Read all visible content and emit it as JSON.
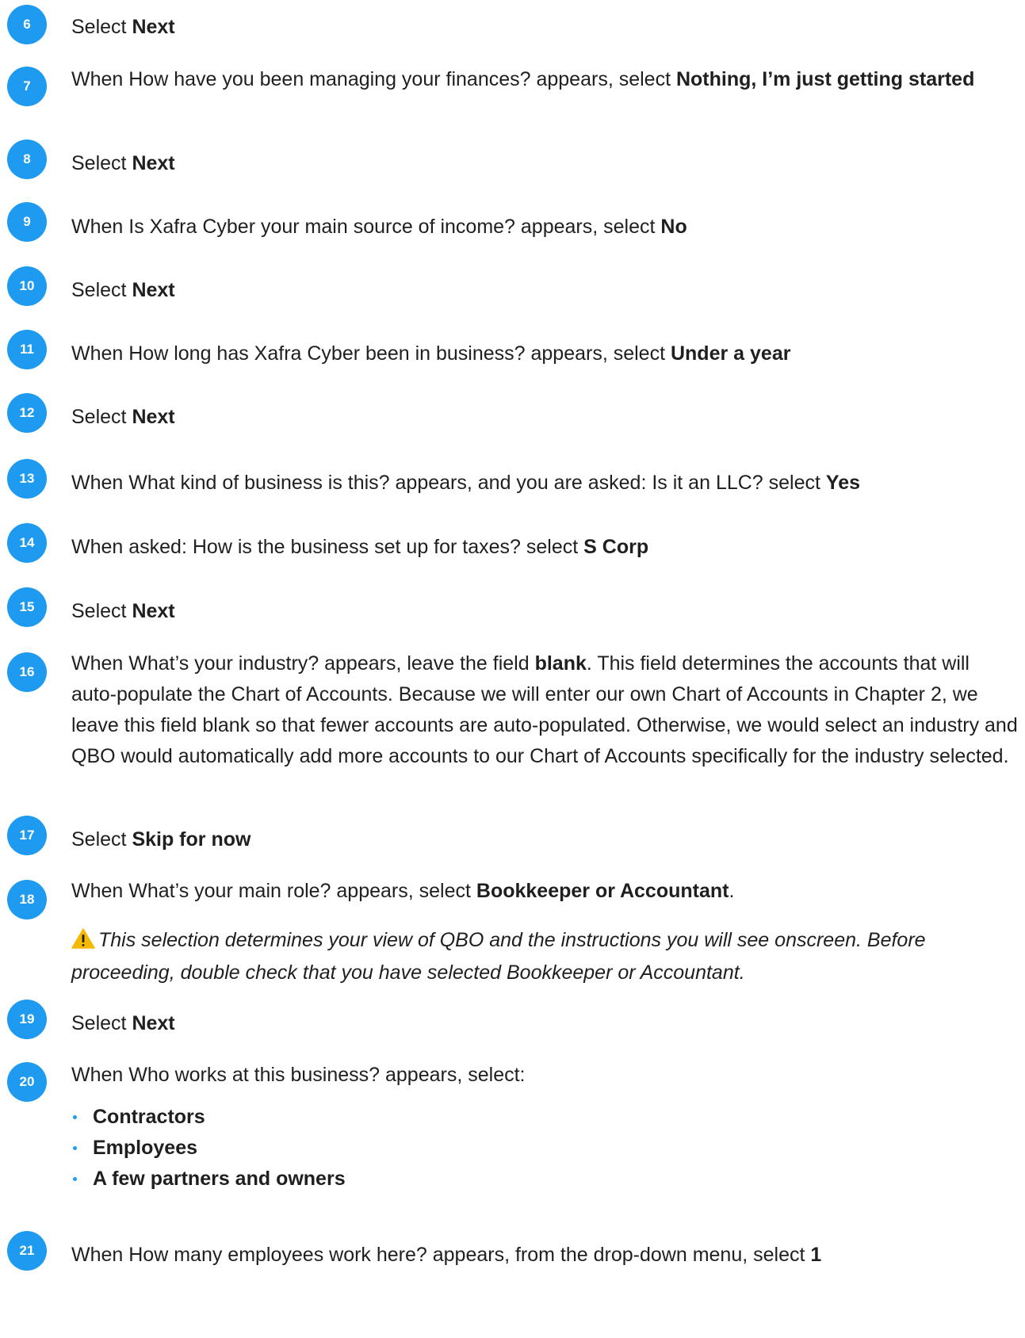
{
  "steps": [
    {
      "num": "6",
      "pre": "Select ",
      "bold": "Next",
      "post": ""
    },
    {
      "num": "7",
      "pre": "When How have you been managing your finances? appears, select ",
      "bold": "Nothing, I’m just getting started",
      "post": ""
    },
    {
      "num": "8",
      "pre": "Select ",
      "bold": "Next",
      "post": ""
    },
    {
      "num": "9",
      "pre": "When Is Xafra Cyber your main source of income? appears, select ",
      "bold": "No",
      "post": ""
    },
    {
      "num": "10",
      "pre": "Select ",
      "bold": "Next",
      "post": ""
    },
    {
      "num": "11",
      "pre": "When How long has Xafra Cyber been in business? appears, select ",
      "bold": "Under a year",
      "post": ""
    },
    {
      "num": "12",
      "pre": "Select ",
      "bold": "Next",
      "post": ""
    },
    {
      "num": "13",
      "pre": "When What kind of business is this? appears, and you are asked: Is it an LLC? select ",
      "bold": "Yes",
      "post": ""
    },
    {
      "num": "14",
      "pre": "When asked: How is the business set up for taxes? select ",
      "bold": "S Corp",
      "post": ""
    },
    {
      "num": "15",
      "pre": "Select ",
      "bold": "Next",
      "post": ""
    },
    {
      "num": "16",
      "pre": "When What’s your industry? appears, leave the field ",
      "bold": "blank",
      "post": ". This field determines the accounts that will auto-populate the Chart of Accounts. Because we will enter our own Chart of Accounts in Chapter 2, we leave this field blank so that fewer accounts are auto-populated. Otherwise, we would select an industry and QBO would automatically add more accounts to our Chart of Accounts specifically for the industry selected."
    },
    {
      "num": "17",
      "pre": "Select ",
      "bold": "Skip for now",
      "post": ""
    },
    {
      "num": "18",
      "pre": "When What’s your main role? appears, select ",
      "bold": "Bookkeeper or Accountant",
      "post": "."
    },
    {
      "num": "19",
      "pre": "Select ",
      "bold": "Next",
      "post": ""
    },
    {
      "num": "20",
      "pre": "When Who works at this business? appears, select:",
      "bold": "",
      "post": ""
    },
    {
      "num": "21",
      "pre": "When How many employees work here? appears, from the drop-down menu, select ",
      "bold": "1",
      "post": ""
    }
  ],
  "note": {
    "icon": "warning-icon",
    "text": "This selection determines your view of QBO and the instructions you will see onscreen. Before proceeding, double check that you have selected Bookkeeper or Accountant."
  },
  "bullets": [
    "Contractors",
    "Employees",
    "A few partners and owners"
  ],
  "colors": {
    "badge": "#1e9bf0",
    "warning": "#f5b800"
  }
}
